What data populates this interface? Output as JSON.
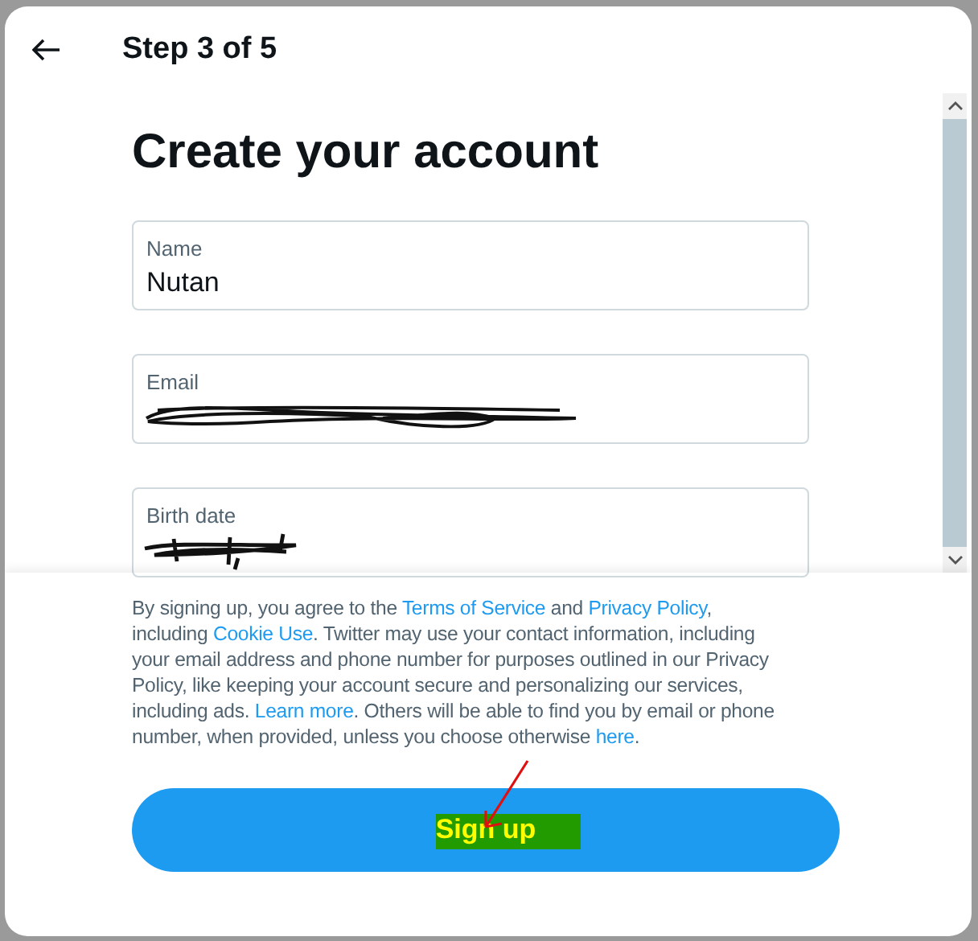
{
  "header": {
    "title": "Step 3 of 5"
  },
  "heading": "Create your account",
  "fields": [
    {
      "label": "Name",
      "value": "Nutan",
      "redacted": false
    },
    {
      "label": "Email",
      "redacted": true
    },
    {
      "label": "Birth date",
      "redacted": true
    }
  ],
  "disclaimer": [
    {
      "text": "By signing up, you agree to the ",
      "link": false
    },
    {
      "text": "Terms of Service",
      "link": true
    },
    {
      "text": " and ",
      "link": false
    },
    {
      "text": "Privacy Policy",
      "link": true
    },
    {
      "text": ", including ",
      "link": false
    },
    {
      "text": "Cookie Use",
      "link": true
    },
    {
      "text": ". Twitter may use your contact information, including your email address and phone number for purposes outlined in our Privacy Policy, like keeping your account secure and personalizing our services, including ads. ",
      "link": false
    },
    {
      "text": "Learn more",
      "link": true
    },
    {
      "text": ". Others will be able to find you by email or phone number, when provided, unless you choose otherwise ",
      "link": false
    },
    {
      "text": "here",
      "link": true
    },
    {
      "text": ".",
      "link": false
    }
  ],
  "signup_button": {
    "label": "Sign up",
    "highlighted": true,
    "annotated": true
  }
}
